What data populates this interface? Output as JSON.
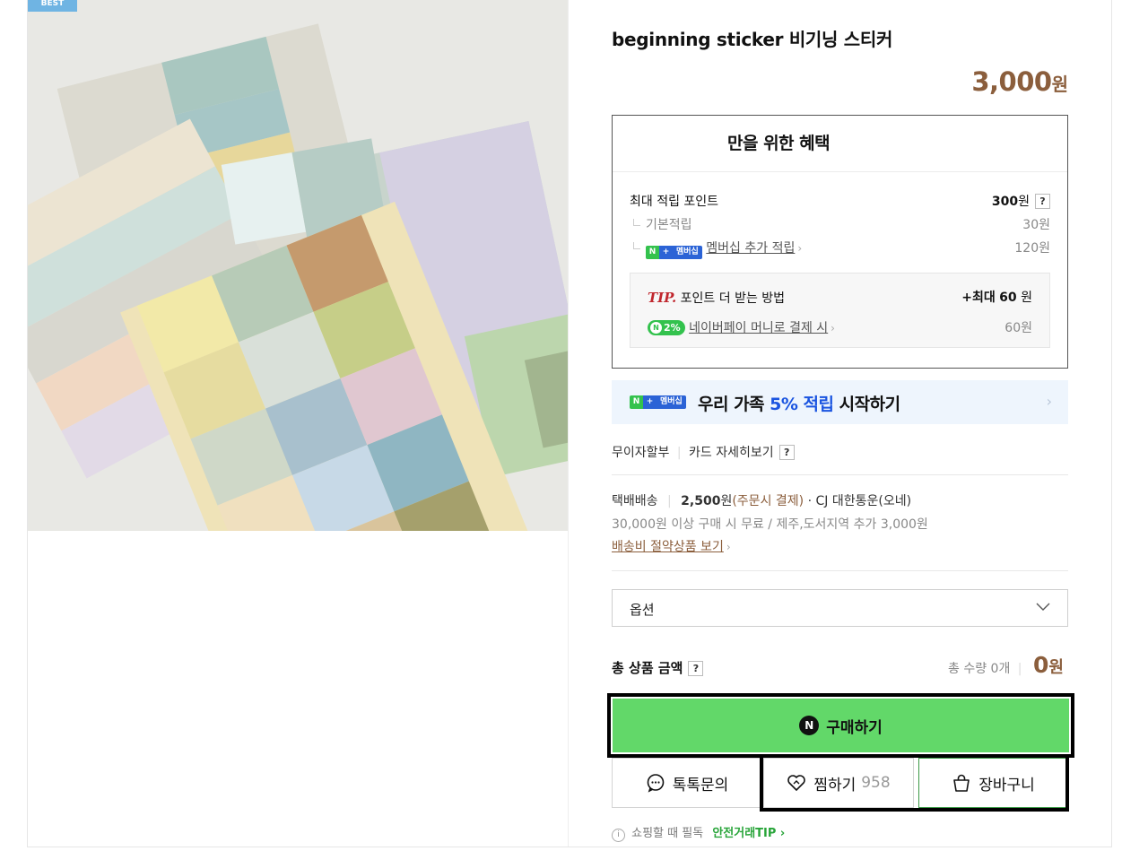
{
  "product": {
    "badge": "BEST",
    "title": "beginning sticker 비기닝 스티커",
    "price": "3,000",
    "price_unit": "원"
  },
  "benefits": {
    "heading": "만을 위한 혜택",
    "max_points_label": "최대 적립 포인트",
    "max_points_value": "300",
    "max_points_unit": "원",
    "basic_label": "기본적립",
    "basic_value": "30원",
    "membership_badge": "멤버십",
    "membership_label": "멤버십 추가 적립",
    "membership_value": "120원",
    "tip_label": "TIP.",
    "tip_text": "포인트 더 받는 방법",
    "tip_max_prefix": "+최대",
    "tip_max_value": "60",
    "tip_max_unit": "원",
    "pay_badge": "2%",
    "pay_label": "네이버페이 머니로 결제 시",
    "pay_value": "60원"
  },
  "promo": {
    "badge": "멤버십",
    "text_pre": "우리 가족",
    "text_highlight": "5% 적립",
    "text_post": "시작하기"
  },
  "payment": {
    "installment": "무이자할부",
    "card_detail": "카드 자세히보기"
  },
  "shipping": {
    "label": "택배배송",
    "fee": "2,500",
    "fee_unit": "원",
    "fee_note": "(주문시 결제)",
    "carrier": "· CJ 대한통운(오네)",
    "condition": "30,000원 이상 구매 시 무료 / 제주,도서지역 추가 3,000원",
    "saving_link": "배송비 절약상품 보기"
  },
  "option": {
    "placeholder": "옵션"
  },
  "total": {
    "label": "총 상품 금액",
    "qty": "총 수량 0개",
    "price": "0",
    "unit": "원"
  },
  "actions": {
    "buy": "구매하기",
    "talk": "톡톡문의",
    "wish": "찜하기",
    "wish_count": "958",
    "cart": "장바구니"
  },
  "safety": {
    "text": "쇼핑할 때 필독",
    "link": "안전거래TIP"
  },
  "colors": {
    "price_brown": "#8b5e3c",
    "buy_green": "#62d869",
    "promo_blue": "#1a54e0"
  }
}
